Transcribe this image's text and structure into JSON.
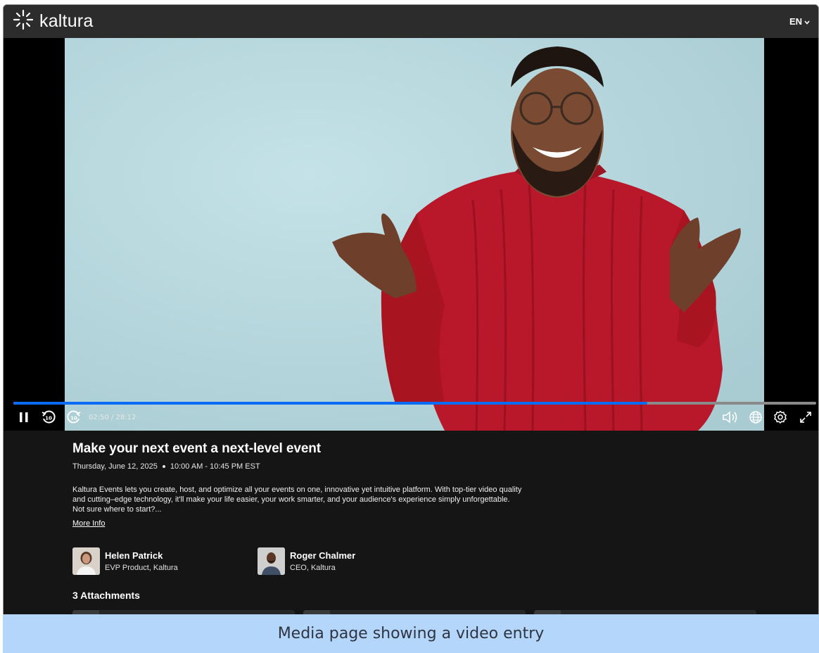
{
  "header": {
    "brand": "kaltura",
    "brand_icon": "kaltura-starburst-icon",
    "language": "EN",
    "language_icon": "chevron-down-icon"
  },
  "player": {
    "current_time": "02:50",
    "duration": "28:12",
    "time_display": "02:50 / 28:12",
    "progress_fraction": 0.79,
    "accent_color": "#0a6cf5",
    "controls": [
      "pause-icon",
      "rewind-10-icon",
      "forward-10-icon",
      "volume-icon",
      "language-globe-icon",
      "settings-gear-icon",
      "fullscreen-icon"
    ]
  },
  "event": {
    "title": "Make your next event a next-level event",
    "date": "Thursday, June 12, 2025",
    "time_range": "10:00 AM - 10:45 PM EST",
    "description": "Kaltura Events lets you create, host, and optimize all your events on one, innovative yet intuitive platform. With top-tier video quality and cutting–edge technology, it'll make your life easier, your work smarter, and your audience's experience simply unforgettable. Not sure where to start?...",
    "more_info_label": "More Info"
  },
  "speakers": [
    {
      "name": "Helen Patrick",
      "role": "EVP Product, Kaltura"
    },
    {
      "name": "Roger Chalmer",
      "role": "CEO, Kaltura"
    }
  ],
  "attachments": {
    "title": "3 Attachments",
    "count": 3
  },
  "caption": "Media page showing a video entry"
}
